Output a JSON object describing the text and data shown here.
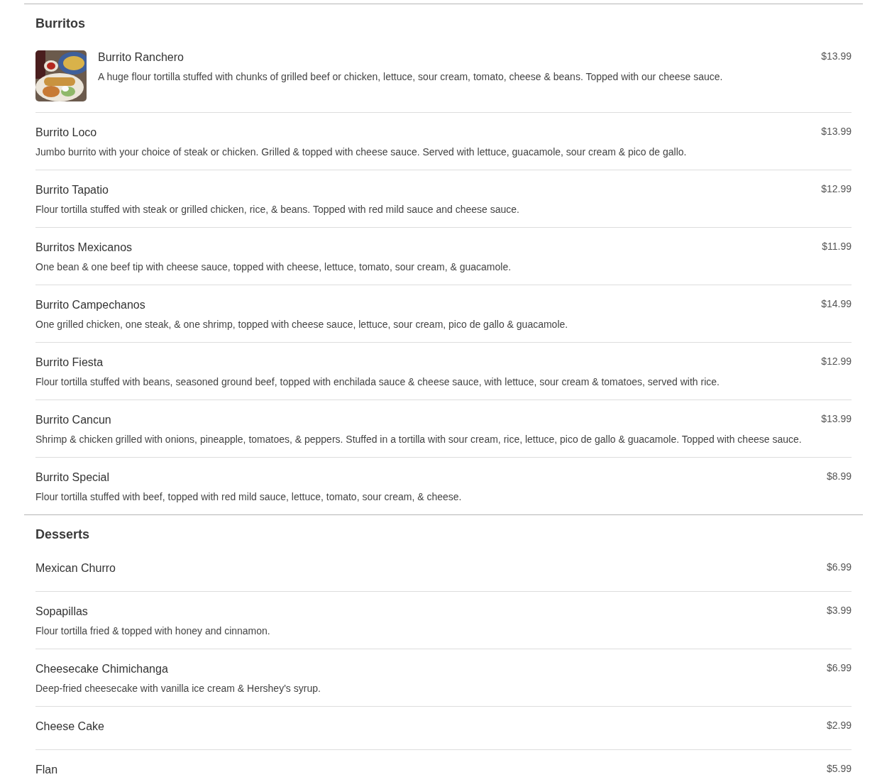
{
  "sections": [
    {
      "title": "Burritos",
      "items": [
        {
          "name": "Burrito Ranchero",
          "price": "$13.99",
          "description": "A huge flour tortilla stuffed with chunks of grilled beef or chicken, lettuce, sour cream, tomato, cheese & beans. Topped with our cheese sauce."
        },
        {
          "name": "Burrito Loco",
          "price": "$13.99",
          "description": "Jumbo burrito with your choice of steak or chicken. Grilled & topped with cheese sauce. Served with lettuce, guacamole, sour cream & pico de gallo."
        },
        {
          "name": "Burrito Tapatio",
          "price": "$12.99",
          "description": "Flour tortilla stuffed with steak or grilled chicken, rice, & beans. Topped with red mild sauce and cheese sauce."
        },
        {
          "name": "Burritos Mexicanos",
          "price": "$11.99",
          "description": "One bean & one beef tip with cheese sauce, topped with cheese, lettuce, tomato, sour cream, & guacamole."
        },
        {
          "name": "Burrito Campechanos",
          "price": "$14.99",
          "description": "One grilled chicken, one steak, & one shrimp, topped with cheese sauce, lettuce, sour cream, pico de gallo & guacamole."
        },
        {
          "name": "Burrito Fiesta",
          "price": "$12.99",
          "description": "Flour tortilla stuffed with beans, seasoned ground beef, topped with enchilada sauce & cheese sauce, with lettuce, sour cream & tomatoes, served with rice."
        },
        {
          "name": "Burrito Cancun",
          "price": "$13.99",
          "description": "Shrimp & chicken grilled with onions, pineapple, tomatoes, & peppers. Stuffed in a tortilla with sour cream, rice, lettuce, pico de gallo & guacamole. Topped with cheese sauce."
        },
        {
          "name": "Burrito Special",
          "price": "$8.99",
          "description": "Flour tortilla stuffed with beef, topped with red mild sauce, lettuce, tomato, sour cream, & cheese."
        }
      ]
    },
    {
      "title": "Desserts",
      "items": [
        {
          "name": "Mexican Churro",
          "price": "$6.99"
        },
        {
          "name": "Sopapillas",
          "price": "$3.99",
          "description": "Flour tortilla fried & topped with honey and cinnamon."
        },
        {
          "name": "Cheesecake Chimichanga",
          "price": "$6.99",
          "description": "Deep-fried cheesecake with vanilla ice cream & Hershey's syrup."
        },
        {
          "name": "Cheese Cake",
          "price": "$2.99"
        },
        {
          "name": "Flan",
          "price": "$5.99"
        }
      ]
    }
  ]
}
